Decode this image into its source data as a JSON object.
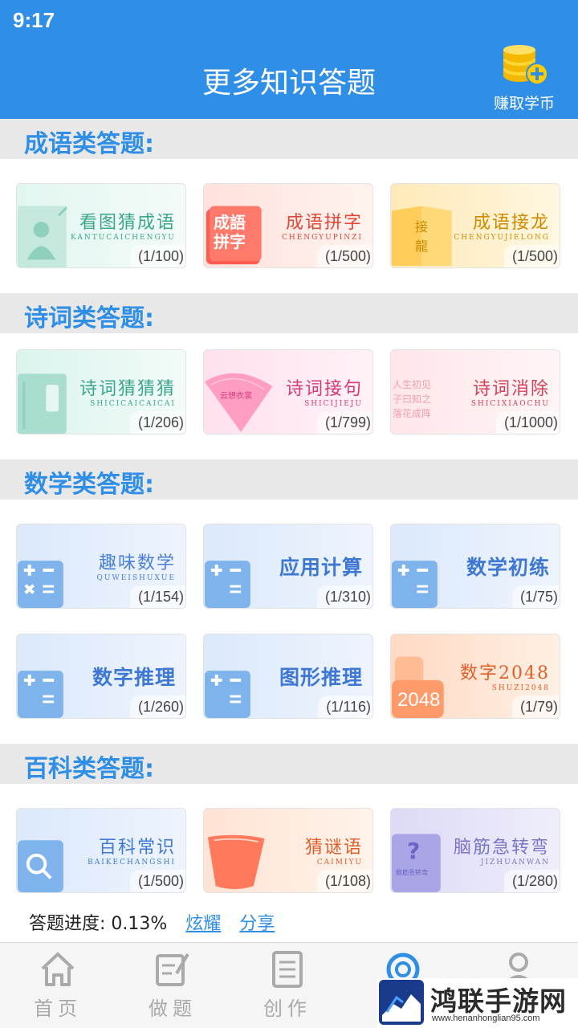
{
  "status_bar": {
    "time": "9:17"
  },
  "header": {
    "title": "更多知识答题",
    "earn_label": "赚取学币",
    "earn_icon": "coins-plus-icon"
  },
  "colors": {
    "primary": "#2f8ee6",
    "section_bg": "#e8e8e8"
  },
  "sections": [
    {
      "title": "成语类答题:",
      "cards": [
        {
          "name": "看图猜成语",
          "pinyin": "KANTUCAICHENGYU",
          "count": "(1/100)"
        },
        {
          "name": "成语拼字",
          "pinyin": "CHENGYUPINZI",
          "count": "(1/500)",
          "art_text": [
            "成語",
            "拼字"
          ]
        },
        {
          "name": "成语接龙",
          "pinyin": "CHENGYUJIELONG",
          "count": "(1/500)",
          "art_text": [
            "接",
            "龍"
          ]
        }
      ]
    },
    {
      "title": "诗词类答题:",
      "cards": [
        {
          "name": "诗词猜猜猜",
          "pinyin": "SHICICAICAICAI",
          "count": "(1/206)"
        },
        {
          "name": "诗词接句",
          "pinyin": "SHICIJIEJU",
          "count": "(1/799)",
          "art_text": [
            "云想衣裳"
          ]
        },
        {
          "name": "诗词消除",
          "pinyin": "SHICIXIAOCHU",
          "count": "(1/1000)",
          "art_text": [
            "人生初见",
            "子曰知之",
            "落花成阵"
          ]
        }
      ]
    },
    {
      "title": "数学类答题:",
      "cards": [
        {
          "name": "趣味数学",
          "pinyin": "QUWEISHUXUE",
          "count": "(1/154)"
        },
        {
          "name": "应用计算",
          "pinyin": "",
          "count": "(1/310)"
        },
        {
          "name": "数学初练",
          "pinyin": "",
          "count": "(1/75)"
        },
        {
          "name": "数字推理",
          "pinyin": "",
          "count": "(1/260)"
        },
        {
          "name": "图形推理",
          "pinyin": "",
          "count": "(1/116)"
        },
        {
          "name": "数字2048",
          "pinyin": "SHUZI2048",
          "count": "(1/79)",
          "art_text": [
            "2048"
          ]
        }
      ]
    },
    {
      "title": "百科类答题:",
      "cards": [
        {
          "name": "百科常识",
          "pinyin": "BAIKECHANGSHI",
          "count": "(1/500)"
        },
        {
          "name": "猜谜语",
          "pinyin": "CAIMIYU",
          "count": "(1/108)"
        },
        {
          "name": "脑筋急转弯",
          "pinyin": "JIZHUANWAN",
          "count": "(1/280)",
          "art_text": [
            "?",
            "脑筋急转弯"
          ]
        }
      ]
    }
  ],
  "progress": {
    "label": "答题进度:",
    "value": "0.13%",
    "link1": "炫耀",
    "link2": "分享"
  },
  "tabs": [
    {
      "label": "首页",
      "icon": "home-icon"
    },
    {
      "label": "做题",
      "icon": "edit-icon"
    },
    {
      "label": "创作",
      "icon": "document-icon"
    },
    {
      "label": "",
      "icon": "refresh-icon"
    },
    {
      "label": "",
      "icon": "user-icon"
    }
  ],
  "watermark": {
    "title": "鸿联手游网",
    "url": "www.henanhonglian95.com"
  }
}
